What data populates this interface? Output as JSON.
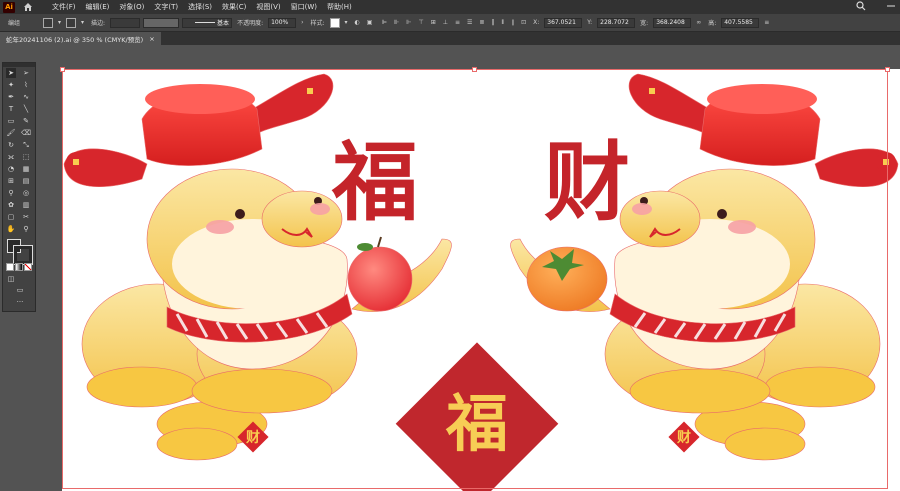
{
  "menubar": {
    "logo": "Ai",
    "items": [
      "文件(F)",
      "编辑(E)",
      "对象(O)",
      "文字(T)",
      "选择(S)",
      "效果(C)",
      "视图(V)",
      "窗口(W)",
      "帮助(H)"
    ]
  },
  "control_bar": {
    "group_label": "编组",
    "stroke_label": "描边:",
    "brush_label": "基本",
    "opacity_label": "不透明度:",
    "opacity_value": "100%",
    "style_label": "样式:",
    "x_label": "X:",
    "x_value": "367.0521",
    "y_label": "Y:",
    "y_value": "228.7072",
    "w_label": "宽:",
    "w_value": "368.2408",
    "h_label": "高:",
    "h_value": "407.5585"
  },
  "document_tab": {
    "title": "蛇年20241106 (2).ai @ 350 % (CMYK/预览)",
    "close": "×"
  },
  "artwork": {
    "left_char": "福",
    "right_char": "财",
    "center_char": "福",
    "badge_char": "财"
  },
  "colors": {
    "red": "#d7262c",
    "dark_red": "#c0272d",
    "yellow": "#f7cd55",
    "selection": "#e96a6a"
  }
}
